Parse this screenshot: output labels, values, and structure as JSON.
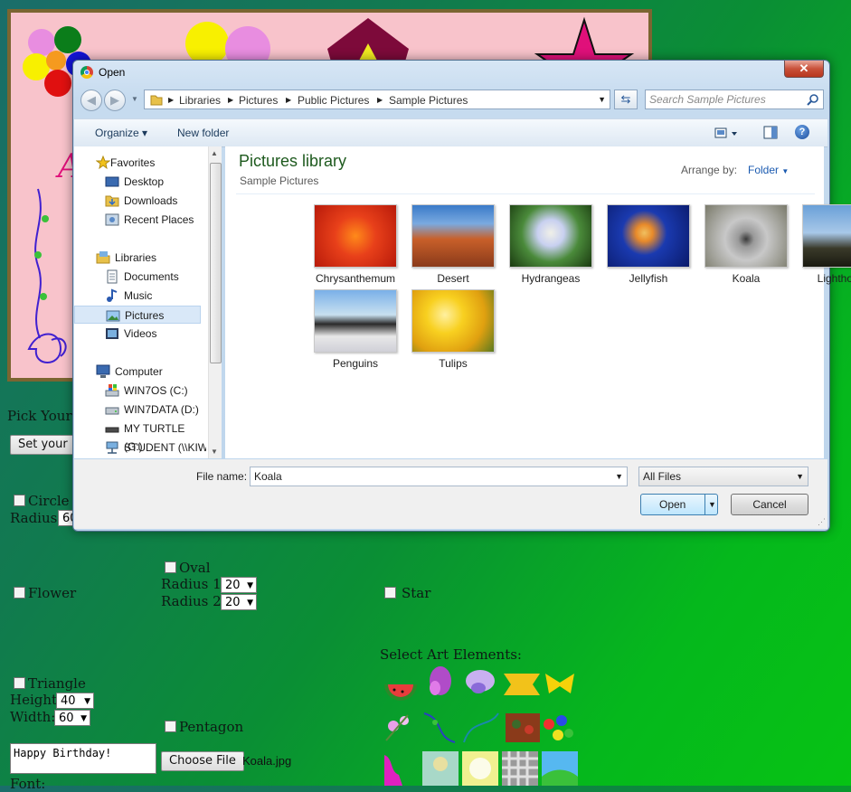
{
  "page": {
    "canvas_text": "A",
    "pick_label": "Pick Your C",
    "set_button": "Set your C",
    "circle_label": "Circle",
    "radius_label": "Radius:",
    "radius_value": "60",
    "flower_label": "Flower",
    "oval_label": "Oval",
    "radius1_label": "Radius 1:",
    "radius1_value": "20",
    "radius2_label": "Radius 2:",
    "radius2_value": "20",
    "star_label": "Star",
    "triangle_label": "Triangle",
    "height_label": "Height:",
    "height_value": "40",
    "width_label": "Width:",
    "width_value": "60",
    "pentagon_label": "Pentagon",
    "select_art_label": "Select Art Elements:",
    "message_text": "Happy Birthday!",
    "choose_file_button": "Choose File",
    "chosen_file": "Koala.jpg",
    "font_label": "Font:"
  },
  "dialog": {
    "title": "Open",
    "close_glyph": "✕",
    "breadcrumbs": [
      "Libraries",
      "Pictures",
      "Public Pictures",
      "Sample Pictures"
    ],
    "search_placeholder": "Search Sample Pictures",
    "toolbar": {
      "organize": "Organize ▾",
      "new_folder": "New folder"
    },
    "nav": {
      "favorites": "Favorites",
      "desktop": "Desktop",
      "downloads": "Downloads",
      "recent_places": "Recent Places",
      "libraries": "Libraries",
      "documents": "Documents",
      "music": "Music",
      "pictures": "Pictures",
      "videos": "Videos",
      "computer": "Computer",
      "drive_c": "WIN7OS (C:)",
      "drive_d": "WIN7DATA (D:)",
      "drive_g": "MY TURTLE (G:)",
      "drive_student": "STUDENT (\\\\KIW"
    },
    "library_title": "Pictures library",
    "library_subtitle": "Sample Pictures",
    "arrange_by_label": "Arrange by:",
    "arrange_by_value": "Folder",
    "files": [
      "Chrysanthemum",
      "Desert",
      "Hydrangeas",
      "Jellyfish",
      "Koala",
      "Lighthouse",
      "Penguins",
      "Tulips"
    ],
    "file_name_label": "File name:",
    "file_name_value": "Koala",
    "file_type_value": "All Files",
    "open_button": "Open",
    "cancel_button": "Cancel"
  }
}
